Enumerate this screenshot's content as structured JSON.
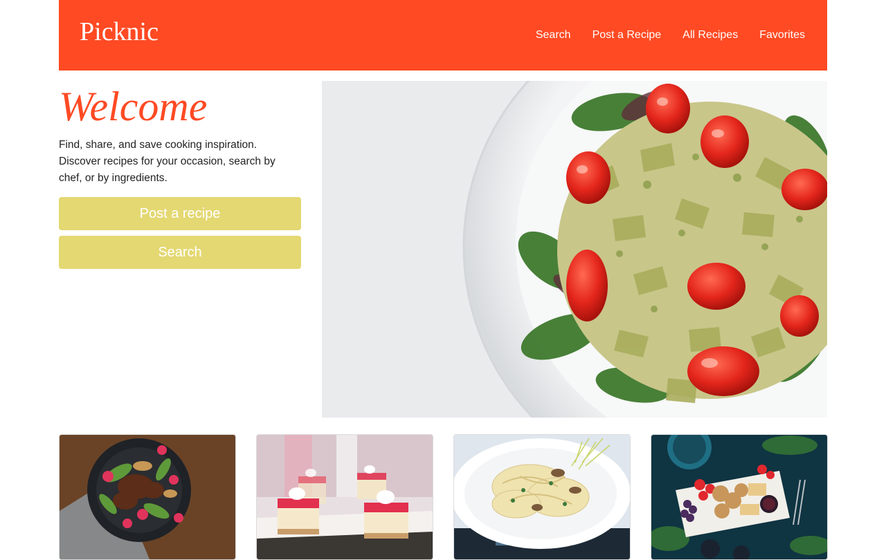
{
  "brand": {
    "name": "Picknic",
    "color": "#ff4a23"
  },
  "nav": {
    "items": [
      {
        "label": "Search"
      },
      {
        "label": "Post a Recipe"
      },
      {
        "label": "All Recipes"
      },
      {
        "label": "Favorites"
      }
    ]
  },
  "hero": {
    "heading": "Welcome",
    "description": "Find, share, and save cooking inspiration. Discover recipes for your occasion, search by chef, or by ingredients.",
    "buttons": {
      "post_label": "Post a recipe",
      "search_label": "Search"
    },
    "button_color": "#e4d873",
    "image": "pasta-salad-photo"
  },
  "recipe_cards": [
    {
      "image": "steak-salad-photo"
    },
    {
      "image": "cheesecake-bars-photo"
    },
    {
      "image": "fettuccine-pasta-photo"
    },
    {
      "image": "charcuterie-board-photo"
    }
  ]
}
